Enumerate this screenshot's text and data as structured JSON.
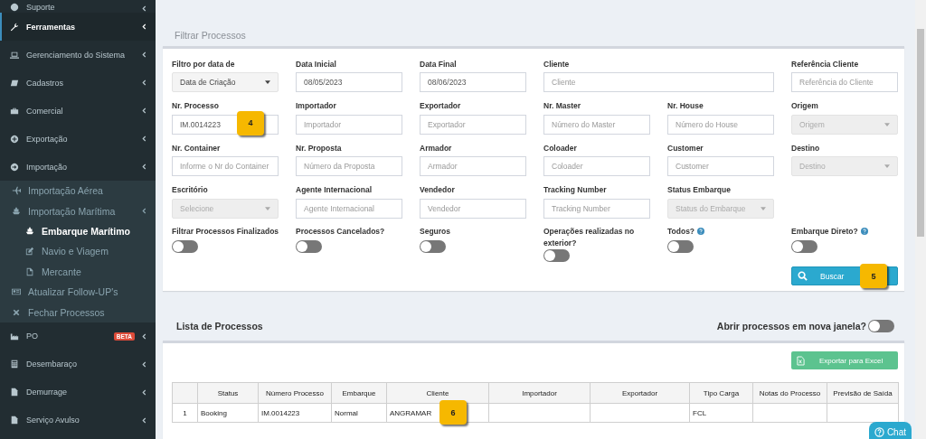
{
  "sidebar": {
    "items": [
      {
        "label": "Suporte",
        "selected": false,
        "submenu": true
      },
      {
        "label": "Ferramentas",
        "selected": true,
        "submenu": true
      },
      {
        "label": "Gerenciamento do Sistema",
        "selected": false,
        "submenu": true
      },
      {
        "label": "Cadastros",
        "selected": false,
        "submenu": true
      },
      {
        "label": "Comercial",
        "selected": false,
        "submenu": true
      },
      {
        "label": "Exportação",
        "selected": false,
        "submenu": true
      },
      {
        "label": "Importação",
        "selected": false,
        "submenu": true,
        "children": [
          {
            "label": "Importação Aérea",
            "selected": false,
            "submenu": false
          },
          {
            "label": "Importação Marítima",
            "selected": false,
            "submenu": true,
            "children": [
              {
                "label": "Embarque Marítimo",
                "selected": true,
                "submenu": false
              },
              {
                "label": "Navio e Viagem",
                "selected": false,
                "submenu": false
              },
              {
                "label": "Mercante",
                "selected": false,
                "submenu": false
              }
            ]
          },
          {
            "label": "Atualizar Follow-UP's",
            "selected": false,
            "submenu": false
          },
          {
            "label": "Fechar Processos",
            "selected": false,
            "submenu": false
          }
        ]
      },
      {
        "label": "PO",
        "selected": false,
        "submenu": true,
        "badge": "BETA"
      },
      {
        "label": "Desembaraço",
        "selected": false,
        "submenu": true
      },
      {
        "label": "Demurrage",
        "selected": false,
        "submenu": true
      },
      {
        "label": "Serviço Avulso",
        "selected": false,
        "submenu": true
      }
    ]
  },
  "filter": {
    "title": "Filtrar Processos",
    "fields": [
      {
        "label": "Filtro por data de",
        "kind": "select",
        "value": "Data de Criação",
        "disabled": false
      },
      {
        "label": "Data Inicial",
        "kind": "input",
        "value": "08/05/2023"
      },
      {
        "label": "Data Final",
        "kind": "input",
        "value": "08/06/2023"
      },
      {
        "label": "Cliente",
        "kind": "input",
        "placeholder": "Cliente",
        "wide": true
      },
      {
        "label": "Referência Cliente",
        "kind": "input",
        "placeholder": "Referência do Cliente"
      },
      {
        "label": "Nr. Processo",
        "kind": "input",
        "value": "IM.0014223",
        "callout": "4"
      },
      {
        "label": "Importador",
        "kind": "input",
        "placeholder": "Importador"
      },
      {
        "label": "Exportador",
        "kind": "input",
        "placeholder": "Exportador"
      },
      {
        "label": "Nr. Master",
        "kind": "input",
        "placeholder": "Número do Master"
      },
      {
        "label": "Nr. House",
        "kind": "input",
        "placeholder": "Número do House"
      },
      {
        "label": "Origem",
        "kind": "select",
        "value": "Origem",
        "disabled": true
      },
      {
        "label": "Nr. Container",
        "kind": "input",
        "placeholder": "Informe o Nr do Container"
      },
      {
        "label": "Nr. Proposta",
        "kind": "input",
        "placeholder": "Número da Proposta"
      },
      {
        "label": "Armador",
        "kind": "input",
        "placeholder": "Armador"
      },
      {
        "label": "Coloader",
        "kind": "input",
        "placeholder": "Coloader"
      },
      {
        "label": "Customer",
        "kind": "input",
        "placeholder": "Customer"
      },
      {
        "label": "Destino",
        "kind": "select",
        "value": "Destino",
        "disabled": true
      },
      {
        "label": "Escritório",
        "kind": "select",
        "value": "Selecione",
        "disabled": true
      },
      {
        "label": "Agente Internacional",
        "kind": "input",
        "placeholder": "Agente Internacional"
      },
      {
        "label": "Vendedor",
        "kind": "input",
        "placeholder": "Vendedor"
      },
      {
        "label": "Tracking Number",
        "kind": "input",
        "placeholder": "Tracking Number"
      },
      {
        "label": "Status Embarque",
        "kind": "select",
        "value": "Status do Embarque",
        "disabled": true
      }
    ],
    "toggles": [
      {
        "label": "Filtrar Processos Finalizados",
        "on": false
      },
      {
        "label": "Processos Cancelados?",
        "on": false
      },
      {
        "label": "Seguros",
        "on": false
      },
      {
        "label": "Operações realizadas no exterior?",
        "on": false
      },
      {
        "label": "Todos?",
        "on": false,
        "help": true
      },
      {
        "label": "Embarque Direto?",
        "on": false,
        "help": true
      }
    ],
    "search_button": {
      "label": "Buscar",
      "callout": "5"
    }
  },
  "list": {
    "title": "Lista de Processos",
    "new_window_toggle": {
      "label": "Abrir processos em nova janela?",
      "on": false
    },
    "export_button": {
      "label": "Exportar para Excel"
    },
    "table": {
      "columns": [
        "Status",
        "Número Processo",
        "Embarque",
        "Cliente",
        "Importador",
        "Exportador",
        "Tipo Carga",
        "Notas do Processo",
        "Previsão de Saída"
      ],
      "rows": [
        {
          "number": "1",
          "status": "Booking",
          "numero_processo": "IM.0014223",
          "embarque": "Normal",
          "cliente": "ANGRAMAR",
          "tipo_carga": "FCL",
          "callout": "6"
        }
      ]
    }
  },
  "chat_button": {
    "label": "Chat"
  }
}
